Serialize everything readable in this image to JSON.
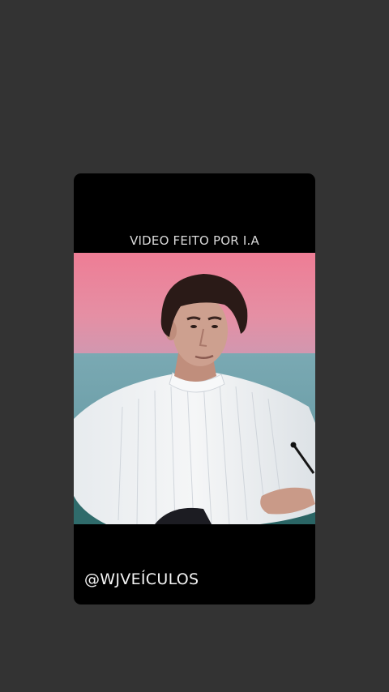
{
  "story": {
    "caption": "VIDEO FEITO POR I.A",
    "handle": "@WJVEÍCULOS"
  },
  "video": {
    "icon": "video-frame-person",
    "colors": {
      "sky_top": "#f07c92",
      "sky_bottom": "#e38a9c",
      "sea": "#6aa1a8",
      "sweater": "#eef0f2",
      "hair": "#2a1a17",
      "skin": "#c99a88",
      "chair": "#2f6b6b"
    }
  }
}
